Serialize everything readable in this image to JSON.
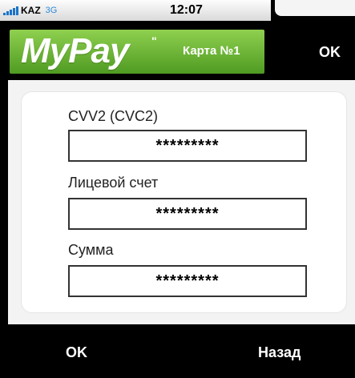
{
  "status_bar": {
    "carrier": "KAZ",
    "network": "3G",
    "time": "12:07"
  },
  "header": {
    "logo": "MyPay",
    "logo_mark": "\"",
    "card_label": "Карта №1",
    "ok_label": "OK"
  },
  "form": {
    "fields": [
      {
        "label": "CVV2 (CVC2)",
        "value": "*********"
      },
      {
        "label": "Лицевой счет",
        "value": "*********"
      },
      {
        "label": "Сумма",
        "value": "*********"
      }
    ]
  },
  "footer": {
    "ok_label": "OK",
    "back_label": "Назад"
  },
  "colors": {
    "brand_green": "#5aa82a",
    "signal_blue": "#1a73c9"
  }
}
